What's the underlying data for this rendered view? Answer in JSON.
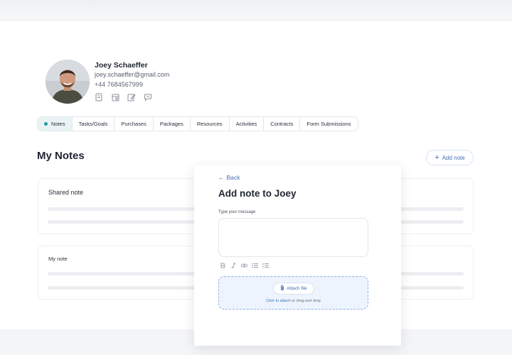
{
  "profile": {
    "name": "Joey Schaeffer",
    "email": "joey.schaeffer@gmail.com",
    "phone": "+44 7684567999",
    "contact_icons": [
      "document-icon",
      "calendar-icon",
      "edit-note-icon",
      "chat-icon"
    ]
  },
  "tabs": [
    {
      "label": "Notes",
      "active": true
    },
    {
      "label": "Tasks/Goals"
    },
    {
      "label": "Purchases"
    },
    {
      "label": "Packages"
    },
    {
      "label": "Resources"
    },
    {
      "label": "Activities"
    },
    {
      "label": "Contracts"
    },
    {
      "label": "Form Submissions"
    }
  ],
  "notes_section": {
    "title": "My Notes",
    "add_note_label": "Add note",
    "cards": [
      {
        "title": "Shared note"
      },
      {
        "title": "My note"
      }
    ]
  },
  "modal": {
    "back_label": "Back",
    "title": "Add note to Joey",
    "message_label": "Type your message",
    "message_value": "",
    "toolbar": [
      "bold-icon",
      "italic-icon",
      "link-icon",
      "bullet-list-icon",
      "numbered-list-icon"
    ],
    "attach_label": "Attach file",
    "drop_link": "Click to attach",
    "drop_rest": " or drag and drop"
  },
  "colors": {
    "accent_blue": "#3f6fb5",
    "active_tab_dot": "#1e9a9e",
    "active_tab_bg": "#e9f3f4",
    "drop_zone_bg": "#eef4fd"
  }
}
